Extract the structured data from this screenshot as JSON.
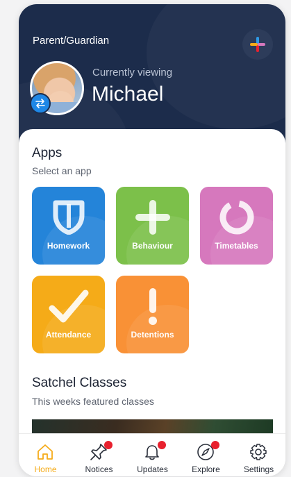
{
  "header": {
    "role_label": "Parent/Guardian",
    "viewing_label": "Currently viewing",
    "child_name": "Michael",
    "colors": {
      "background": "#1c2c4b",
      "swap_badge": "#1e87e6"
    }
  },
  "apps": {
    "title": "Apps",
    "subtitle": "Select an app",
    "tiles": [
      {
        "label": "Homework",
        "color": "#2484d9",
        "icon": "shield-icon"
      },
      {
        "label": "Behaviour",
        "color": "#7cc04a",
        "icon": "plus-icon"
      },
      {
        "label": "Timetables",
        "color": "#d678bd",
        "icon": "ring-icon"
      },
      {
        "label": "Attendance",
        "color": "#f5ab18",
        "icon": "check-icon"
      },
      {
        "label": "Detentions",
        "color": "#f99136",
        "icon": "exclamation-icon"
      }
    ]
  },
  "classes": {
    "title": "Satchel Classes",
    "subtitle": "This weeks featured classes"
  },
  "tabbar": {
    "active_color": "#f5ab18",
    "tabs": [
      {
        "label": "Home",
        "icon": "home-icon",
        "active": true,
        "badge": false
      },
      {
        "label": "Notices",
        "icon": "pin-icon",
        "active": false,
        "badge": true
      },
      {
        "label": "Updates",
        "icon": "bell-icon",
        "active": false,
        "badge": true
      },
      {
        "label": "Explore",
        "icon": "compass-icon",
        "active": false,
        "badge": true
      },
      {
        "label": "Settings",
        "icon": "gear-icon",
        "active": false,
        "badge": false
      }
    ]
  }
}
